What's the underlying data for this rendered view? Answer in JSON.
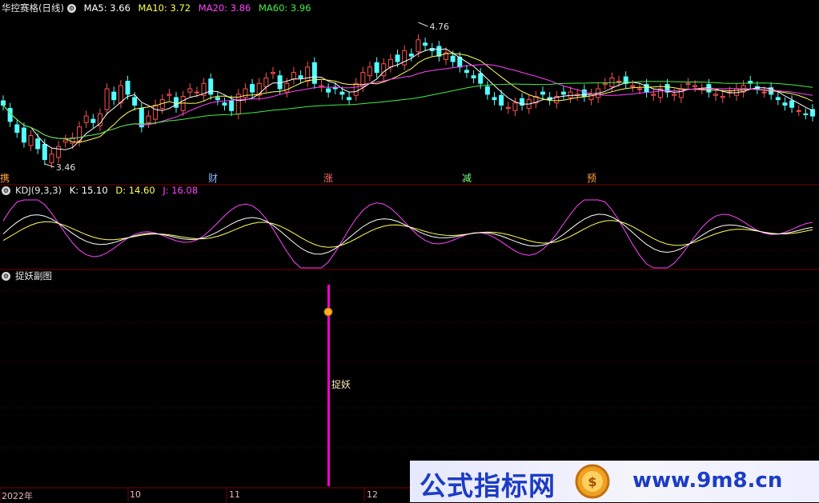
{
  "header_main": {
    "title": "华控赛格(日线)",
    "ma5": "MA5: 3.66",
    "ma10": "MA10: 3.72",
    "ma20": "MA20: 3.86",
    "ma60": "MA60: 3.96"
  },
  "header_kdj": {
    "title": "KDJ(9,3,3)",
    "k": "K: 15.10",
    "d": "D: 14.60",
    "j": "J: 16.08"
  },
  "header_sub": {
    "title": "捉妖副图"
  },
  "annotations": {
    "high": "4.76",
    "low": "3.46",
    "signal": "捉妖"
  },
  "events": [
    "携",
    "财",
    "涨",
    "减",
    "预"
  ],
  "x_axis": [
    "2022年",
    "10",
    "11",
    "12"
  ],
  "watermark": {
    "left": "公式指标网",
    "right": "www.9m8.cn"
  },
  "colors": {
    "up": "#ff5050",
    "down": "#54ffff",
    "ma5": "#ffffff",
    "ma10": "#ffff55",
    "ma20": "#ff44ff",
    "ma60": "#44ee44",
    "grid": "#7a0000",
    "signal": "#ff00cc"
  },
  "chart_data": {
    "type": "candlestick",
    "price_range": [
      3.46,
      4.76
    ],
    "closes": [
      4.0,
      3.85,
      3.75,
      3.66,
      3.72,
      3.6,
      3.5,
      3.55,
      3.62,
      3.68,
      3.7,
      3.8,
      3.9,
      3.84,
      3.92,
      4.15,
      4.05,
      4.18,
      4.1,
      4.0,
      3.8,
      3.9,
      4.0,
      4.05,
      4.1,
      3.98,
      4.08,
      4.15,
      4.12,
      4.2,
      4.1,
      4.05,
      4.0,
      3.95,
      4.1,
      4.15,
      4.12,
      4.2,
      4.25,
      4.3,
      4.15,
      4.2,
      4.3,
      4.25,
      4.35,
      4.2,
      4.18,
      4.12,
      4.15,
      4.1,
      4.05,
      4.2,
      4.3,
      4.35,
      4.3,
      4.38,
      4.42,
      4.4,
      4.5,
      4.45,
      4.6,
      4.55,
      4.5,
      4.45,
      4.48,
      4.4,
      4.35,
      4.3,
      4.25,
      4.2,
      4.1,
      4.05,
      4.0,
      3.98,
      4.02,
      4.0,
      4.05,
      4.08,
      4.1,
      4.05,
      4.08,
      4.1,
      4.12,
      4.1,
      4.08,
      4.1,
      4.15,
      4.2,
      4.25,
      4.22,
      4.2,
      4.18,
      4.15,
      4.12,
      4.1,
      4.15,
      4.12,
      4.1,
      4.15,
      4.2,
      4.18,
      4.15,
      4.12,
      4.1,
      4.08,
      4.12,
      4.15,
      4.18,
      4.2,
      4.15,
      4.12,
      4.1,
      4.05,
      4.0,
      3.98,
      3.95,
      3.92,
      3.9
    ]
  }
}
